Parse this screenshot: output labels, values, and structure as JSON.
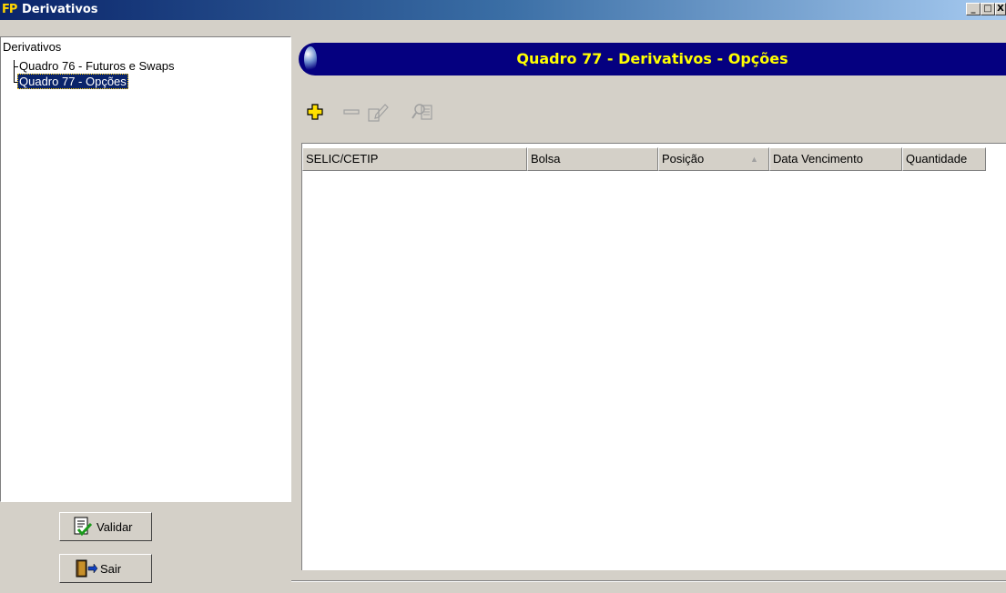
{
  "window": {
    "title": "Derivativos",
    "icon": "FP",
    "controls": {
      "minimize": "_",
      "maximize": "□",
      "close": "X"
    }
  },
  "tree": {
    "root": "Derivativos",
    "items": [
      {
        "label": "Quadro 76 - Futuros e Swaps",
        "selected": false
      },
      {
        "label": "Quadro 77 - Opções",
        "selected": true
      }
    ]
  },
  "buttons": {
    "validate": "Validar",
    "exit": "Sair"
  },
  "header": {
    "title": "Quadro 77 -  Derivativos -  Opções"
  },
  "toolbar": {
    "icons": [
      "add-icon",
      "remove-icon",
      "edit-icon",
      "search-icon"
    ],
    "colors": {
      "add": "#e8d000",
      "disabled": "#a0a0a0"
    }
  },
  "grid": {
    "columns": [
      "SELIC/CETIP",
      "Bolsa",
      "Posição",
      "Data Vencimento",
      "Quantidade"
    ],
    "sort_column": "Posição",
    "sort_indicator": "▲",
    "rows": []
  },
  "colors": {
    "header_bg": "#050080",
    "header_text": "#ffff00",
    "selection": "#0a246a"
  }
}
